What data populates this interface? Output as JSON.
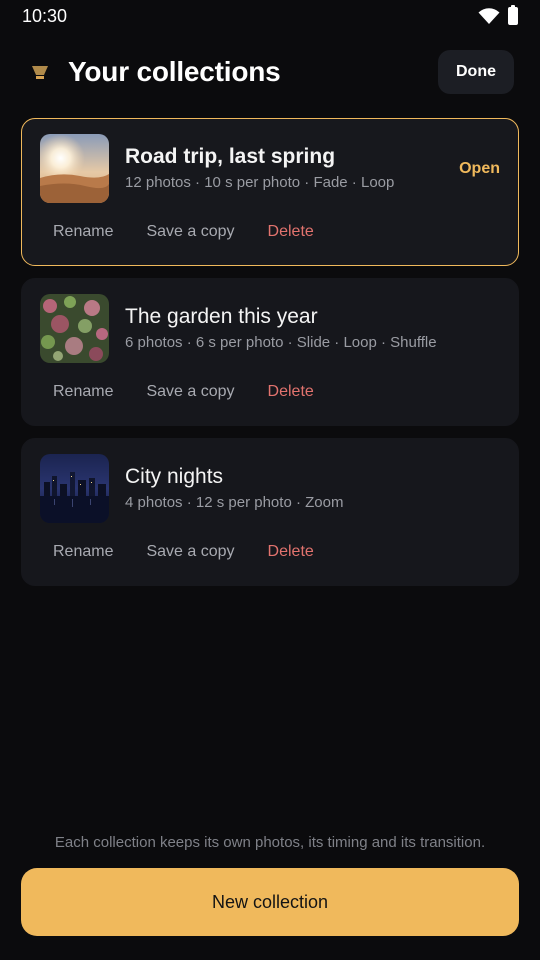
{
  "status_bar": {
    "time": "10:30",
    "icons": [
      "wifi-icon",
      "battery-icon"
    ]
  },
  "header": {
    "title": "Your collections",
    "icon": "collection-lamp-icon",
    "done_label": "Done"
  },
  "collections": [
    {
      "title": "Road trip, last spring",
      "meta": "12 photos · 10 s per photo · Fade · Loop",
      "open_label": "Open",
      "selected": true,
      "actions": {
        "rename": "Rename",
        "copy": "Save a copy",
        "delete": "Delete"
      }
    },
    {
      "title": "The garden this year",
      "meta": "6 photos · 6 s per photo · Slide · Loop · Shuffle",
      "selected": false,
      "actions": {
        "rename": "Rename",
        "copy": "Save a copy",
        "delete": "Delete"
      }
    },
    {
      "title": "City nights",
      "meta": "4 photos · 12 s per photo · Zoom",
      "selected": false,
      "actions": {
        "rename": "Rename",
        "copy": "Save a copy",
        "delete": "Delete"
      }
    }
  ],
  "footer": {
    "note": "Each collection keeps its own photos, its timing and its transition.",
    "new_button_label": "New collection"
  },
  "colors": {
    "background": "#0b0b0d",
    "card": "#16171c",
    "accent": "#f0b95c",
    "danger": "#e2736e",
    "muted": "#9a9ca3"
  }
}
